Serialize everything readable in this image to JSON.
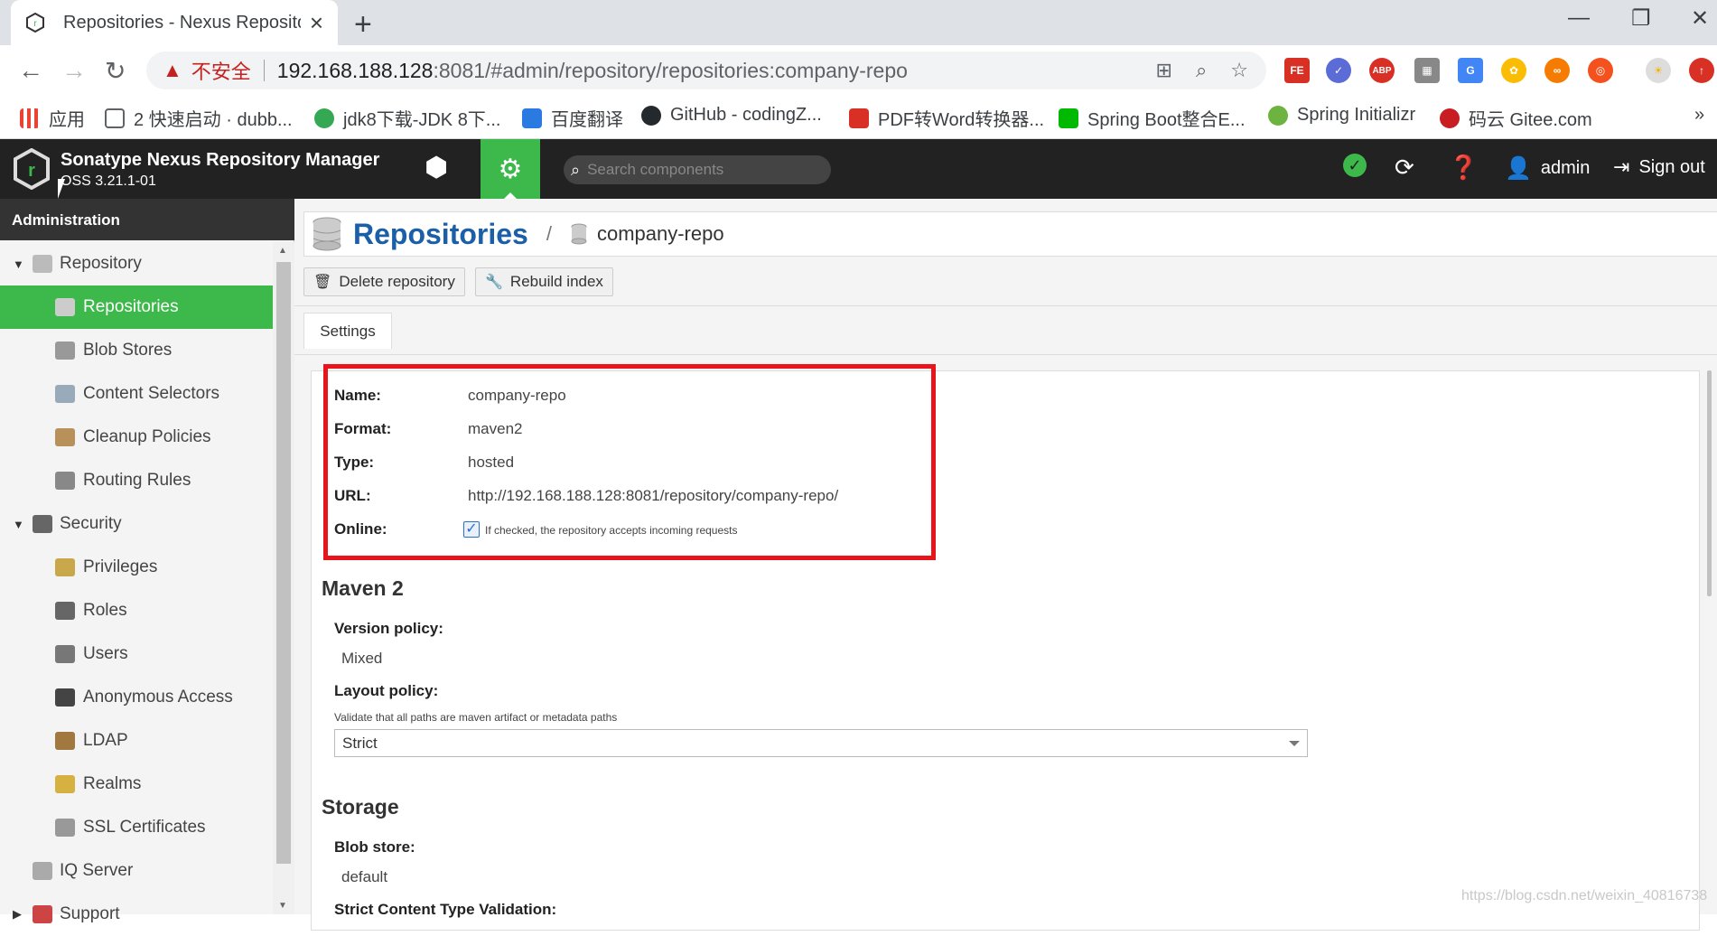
{
  "browser": {
    "tab_title": "Repositories - Nexus Reposito",
    "url_warning": "不安全",
    "url_host": "192.168.188.128",
    "url_path": ":8081/#admin/repository/repositories:company-repo",
    "bookmarks": [
      {
        "label": "应用",
        "color": "#ea4335"
      },
      {
        "label": "2 快速启动 · dubb...",
        "color": "#5f6368"
      },
      {
        "label": "jdk8下载-JDK 8下...",
        "color": "#34a853"
      },
      {
        "label": "百度翻译",
        "color": "#2a7ae2"
      },
      {
        "label": "GitHub - codingZ...",
        "color": "#24292e"
      },
      {
        "label": "PDF转Word转换器...",
        "color": "#d93025"
      },
      {
        "label": "Spring Boot整合E...",
        "color": "#00b900"
      },
      {
        "label": "Spring Initializr",
        "color": "#6db33f"
      },
      {
        "label": "码云 Gitee.com",
        "color": "#c71d23"
      }
    ]
  },
  "header": {
    "title": "Sonatype Nexus Repository Manager",
    "version": "OSS 3.21.1-01",
    "search_placeholder": "Search components",
    "user": "admin",
    "signout": "Sign out"
  },
  "sidebar": {
    "heading": "Administration",
    "items": [
      {
        "label": "Repository",
        "level": 0,
        "caret": "▼",
        "icon": "database-icon",
        "color": "#bbb"
      },
      {
        "label": "Repositories",
        "level": 1,
        "active": true,
        "icon": "database-icon",
        "color": "#ccc"
      },
      {
        "label": "Blob Stores",
        "level": 1,
        "icon": "server-icon",
        "color": "#999"
      },
      {
        "label": "Content Selectors",
        "level": 1,
        "icon": "selector-icon",
        "color": "#9ab"
      },
      {
        "label": "Cleanup Policies",
        "level": 1,
        "icon": "broom-icon",
        "color": "#b8905a"
      },
      {
        "label": "Routing Rules",
        "level": 1,
        "icon": "routing-icon",
        "color": "#888"
      },
      {
        "label": "Security",
        "level": 0,
        "caret": "▼",
        "icon": "eye-icon",
        "color": "#666"
      },
      {
        "label": "Privileges",
        "level": 1,
        "icon": "medal-icon",
        "color": "#c8a84a"
      },
      {
        "label": "Roles",
        "level": 1,
        "icon": "role-icon",
        "color": "#666"
      },
      {
        "label": "Users",
        "level": 1,
        "icon": "users-icon",
        "color": "#777"
      },
      {
        "label": "Anonymous Access",
        "level": 1,
        "icon": "id-card-icon",
        "color": "#444"
      },
      {
        "label": "LDAP",
        "level": 1,
        "icon": "book-icon",
        "color": "#a07840"
      },
      {
        "label": "Realms",
        "level": 1,
        "icon": "shield-icon",
        "color": "#d6b040"
      },
      {
        "label": "SSL Certificates",
        "level": 1,
        "icon": "certificate-icon",
        "color": "#999"
      },
      {
        "label": "IQ Server",
        "level": 0,
        "icon": "iq-server-icon",
        "color": "#aaa"
      },
      {
        "label": "Support",
        "level": 0,
        "caret": "▶",
        "icon": "support-icon",
        "color": "#c44"
      }
    ]
  },
  "main": {
    "crumb_title": "Repositories",
    "crumb_sep": "/",
    "crumb_current": "company-repo",
    "delete_label": "Delete repository",
    "rebuild_label": "Rebuild index",
    "settings_tab": "Settings",
    "summary": [
      {
        "key": "Name:",
        "value": "company-repo"
      },
      {
        "key": "Format:",
        "value": "maven2"
      },
      {
        "key": "Type:",
        "value": "hosted"
      },
      {
        "key": "URL:",
        "value": "http://192.168.188.128:8081/repository/company-repo/"
      },
      {
        "key": "Online:",
        "value": ""
      }
    ],
    "online_hint": "If checked, the repository accepts incoming requests",
    "maven_heading": "Maven 2",
    "version_policy_label": "Version policy:",
    "version_policy_value": "Mixed",
    "layout_policy_label": "Layout policy:",
    "layout_policy_hint": "Validate that all paths are maven artifact or metadata paths",
    "layout_policy_value": "Strict",
    "storage_heading": "Storage",
    "blob_store_label": "Blob store:",
    "blob_store_value": "default",
    "strict_label": "Strict Content Type Validation:"
  },
  "watermark": "https://blog.csdn.net/weixin_40816738"
}
